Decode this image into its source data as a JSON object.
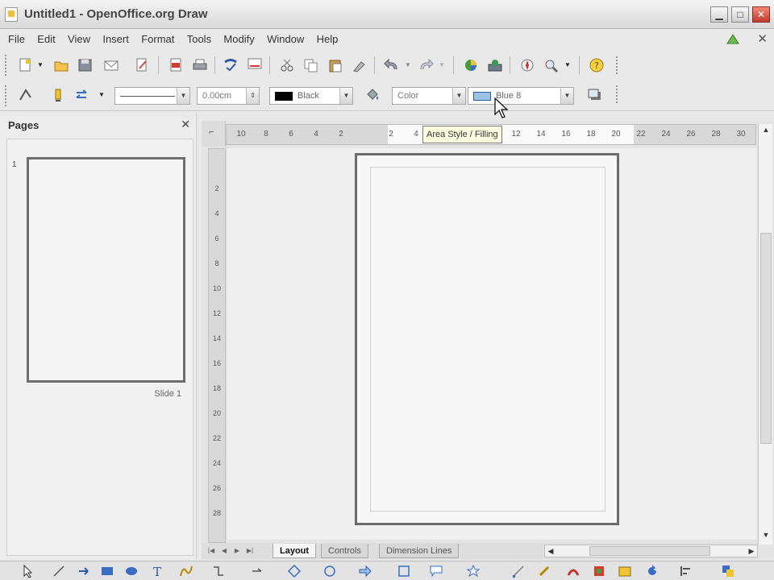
{
  "window": {
    "title": "Untitled1 - OpenOffice.org Draw"
  },
  "menu": [
    "File",
    "Edit",
    "View",
    "Insert",
    "Format",
    "Tools",
    "Modify",
    "Window",
    "Help"
  ],
  "line_format": {
    "line_width": "0.00cm",
    "line_color": "Black",
    "area_style": "Color",
    "area_fill": "Blue 8"
  },
  "tooltip": "Area Style / Filling",
  "pages_panel": {
    "title": "Pages",
    "page_number": "1",
    "slide_label": "Slide 1"
  },
  "hruler_ticks": [
    "10",
    "8",
    "6",
    "4",
    "2",
    "",
    "2",
    "4",
    "6",
    "8",
    "10",
    "12",
    "14",
    "16",
    "18",
    "20",
    "22",
    "24",
    "26",
    "28",
    "30"
  ],
  "vruler_ticks": [
    "2",
    "4",
    "6",
    "8",
    "10",
    "12",
    "14",
    "16",
    "18",
    "20",
    "22",
    "24",
    "26",
    "28"
  ],
  "tabs": [
    "Layout",
    "Controls",
    "Dimension Lines"
  ],
  "colors": {
    "accent": "#2c5aa0",
    "tooltip_bg": "#ffffe1"
  }
}
